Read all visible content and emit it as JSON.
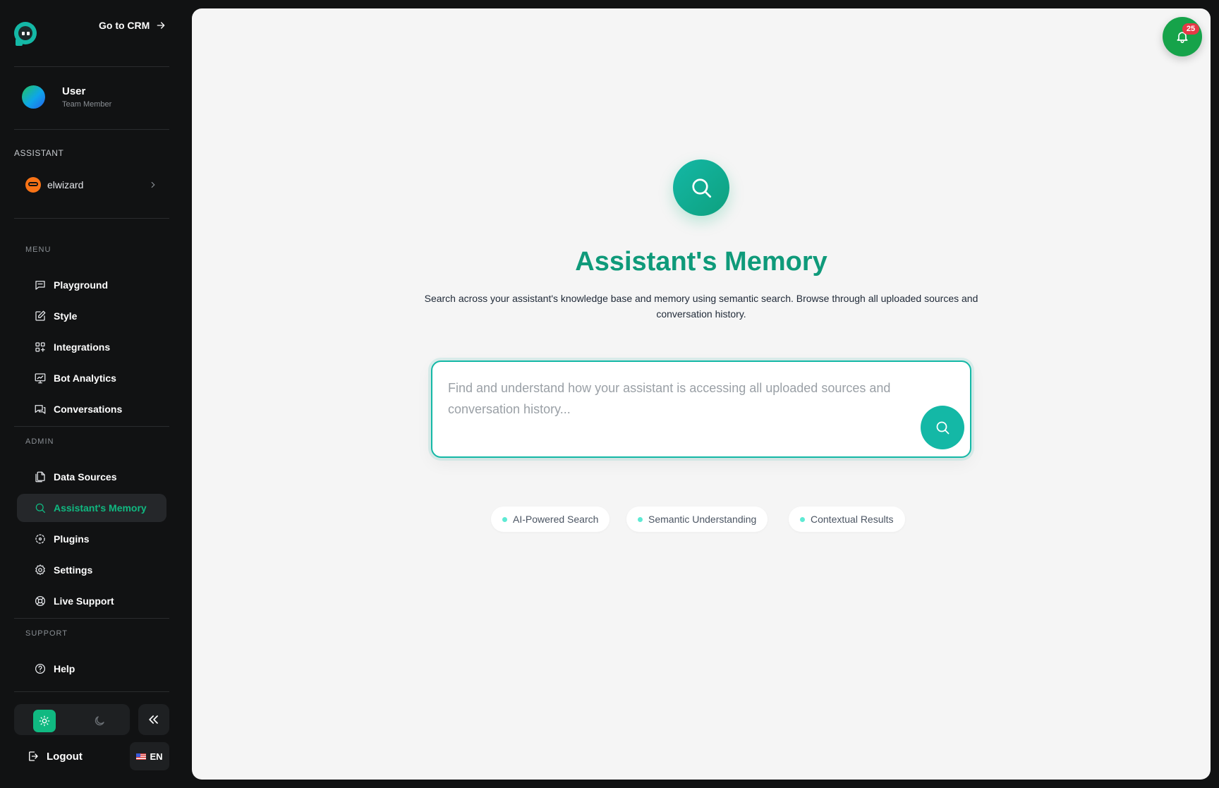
{
  "header": {
    "go_to_crm": "Go to CRM"
  },
  "user": {
    "name": "User",
    "role": "Team Member"
  },
  "assistant": {
    "section_label": "ASSISTANT",
    "name": "elwizard"
  },
  "menu": {
    "title": "MENU",
    "items": [
      {
        "label": "Playground",
        "icon": "chat-icon"
      },
      {
        "label": "Style",
        "icon": "edit-icon"
      },
      {
        "label": "Integrations",
        "icon": "grid-plus-icon"
      },
      {
        "label": "Bot Analytics",
        "icon": "chart-icon"
      },
      {
        "label": "Conversations",
        "icon": "chats-icon"
      }
    ]
  },
  "admin": {
    "title": "ADMIN",
    "items": [
      {
        "label": "Data Sources",
        "icon": "files-icon"
      },
      {
        "label": "Assistant's Memory",
        "icon": "search-icon",
        "active": true
      },
      {
        "label": "Plugins",
        "icon": "plugin-icon"
      },
      {
        "label": "Settings",
        "icon": "gear-icon"
      },
      {
        "label": "Live Support",
        "icon": "lifebuoy-icon"
      }
    ]
  },
  "support": {
    "title": "SUPPORT",
    "items": [
      {
        "label": "Help",
        "icon": "help-icon"
      }
    ]
  },
  "footer": {
    "logout": "Logout",
    "language": "EN"
  },
  "notifications": {
    "count": "25"
  },
  "page": {
    "title": "Assistant's Memory",
    "subtitle": "Search across your assistant's knowledge base and memory using semantic search. Browse through all uploaded sources and conversation history."
  },
  "search": {
    "placeholder": "Find and understand how your assistant is accessing all uploaded sources and conversation history...",
    "value": ""
  },
  "features": [
    "AI-Powered Search",
    "Semantic Understanding",
    "Contextual Results"
  ],
  "colors": {
    "accent": "#14b8a6",
    "active": "#10b981",
    "title": "#0f9a7a",
    "sidebar": "#111213",
    "badge": "#e63946"
  }
}
